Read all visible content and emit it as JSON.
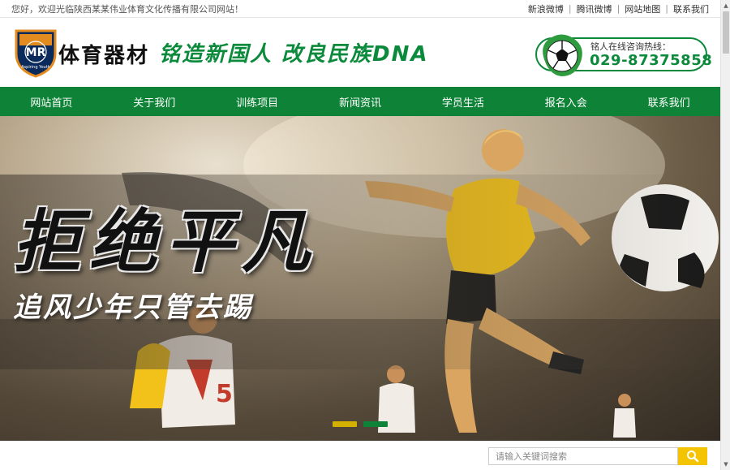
{
  "topbar": {
    "welcome": "您好，欢迎光临陕西某某伟业体育文化传播有限公司网站！",
    "links": [
      {
        "label": "新浪微博"
      },
      {
        "label": "腾讯微博"
      },
      {
        "label": "网站地图"
      },
      {
        "label": "联系我们"
      }
    ]
  },
  "header": {
    "logo_text": "MR",
    "logo_subtext": "Aspiring Youth",
    "brand": "体育器材",
    "slogan": "铭造新国人  改良民族DNA",
    "hotline_label": "铭人在线咨询热线：",
    "hotline_number": "029-87375858"
  },
  "nav": {
    "items": [
      {
        "label": "网站首页"
      },
      {
        "label": "关于我们"
      },
      {
        "label": "训练项目"
      },
      {
        "label": "新闻资讯"
      },
      {
        "label": "学员生活"
      },
      {
        "label": "报名入会"
      },
      {
        "label": "联系我们"
      }
    ]
  },
  "banner": {
    "title": "拒绝平凡",
    "subtitle": "追风少年只管去踢",
    "player_number": "5",
    "dots": [
      {
        "color": "#d4b000",
        "active": false
      },
      {
        "color": "#0e8337",
        "active": true
      }
    ]
  },
  "search": {
    "placeholder": "请输入关键词搜索",
    "icon": "search-icon"
  },
  "colors": {
    "brand_green": "#0e8337",
    "accent_yellow": "#f5c400"
  }
}
